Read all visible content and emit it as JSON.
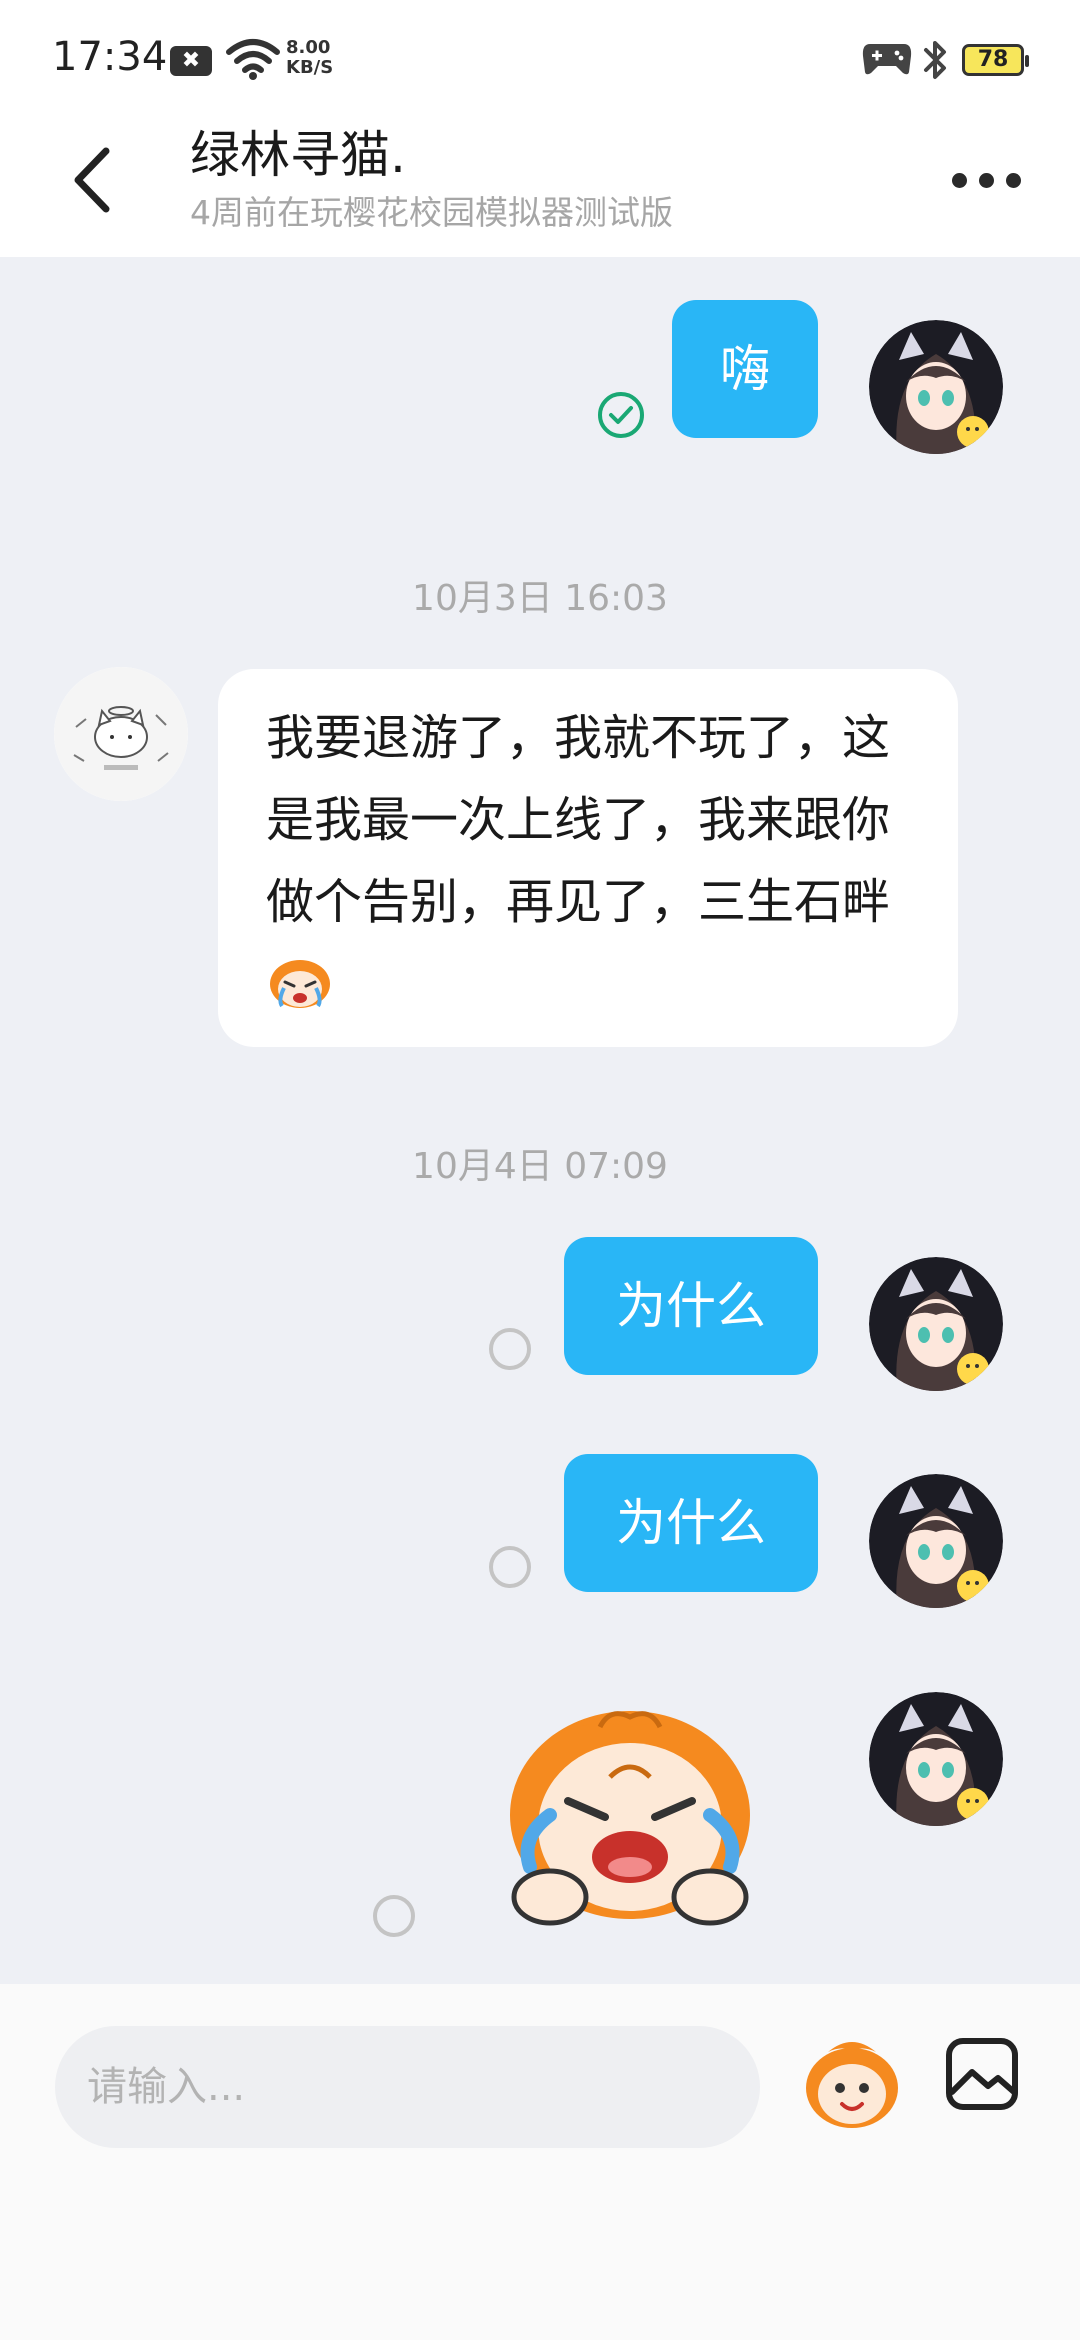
{
  "status_bar": {
    "time": "17:34",
    "speed_value": "8.00",
    "speed_unit": "KB/S",
    "battery": "78"
  },
  "header": {
    "title": "绿林寻猫.",
    "subtitle": "4周前在玩樱花校园模拟器测试版"
  },
  "messages": {
    "m1": {
      "text": "嗨",
      "status": "read"
    },
    "ts1": "10月3日 16:03",
    "m2": {
      "text": "我要退游了，我就不玩了，这是我最一次上线了，我来跟你做个告别，再见了，三生石畔"
    },
    "ts2": "10月4日 07:09",
    "m3": {
      "text": "为什么",
      "status": "unread"
    },
    "m4": {
      "text": "为什么",
      "status": "unread"
    },
    "m5": {
      "sticker": "crying-monkey-sticker",
      "status": "unread"
    }
  },
  "input": {
    "placeholder": "请输入..."
  },
  "colors": {
    "accent": "#29b6f6",
    "check": "#1aa874",
    "background": "#eef0f5"
  }
}
